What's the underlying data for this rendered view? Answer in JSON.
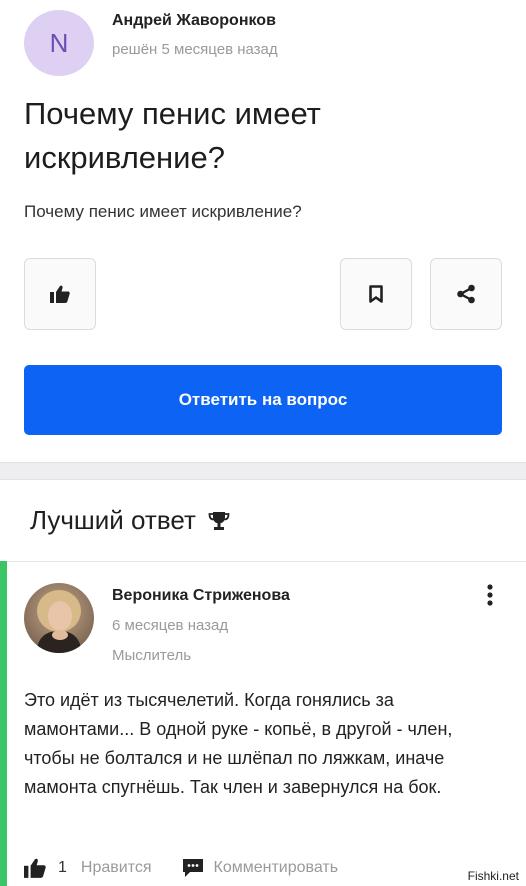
{
  "question": {
    "author": {
      "initial": "N",
      "name": "Андрей Жаворонков",
      "meta": "решён 5 месяцев назад",
      "avatar_color": "#ddd0f2"
    },
    "title": "Почему пенис имеет искривление?",
    "body": "Почему пенис имеет искривление?",
    "actions": {
      "like_icon": "thumbs-up-icon",
      "bookmark_icon": "bookmark-icon",
      "share_icon": "share-icon"
    },
    "answer_button_label": "Ответить на вопрос",
    "accent_color": "#0d63f3"
  },
  "best_answer": {
    "section_title": "Лучший ответ",
    "section_icon": "trophy-icon",
    "author": {
      "name": "Вероника Стриженова",
      "date": "6 месяцев назад",
      "rank": "Мыслитель"
    },
    "text": "Это идёт из тысячелетий. Когда гонялись за мамонтами... В одной руке - копьё, в другой - член, чтобы не болтался и не шлёпал по ляжкам, иначе мамонта спугнёшь. Так член и завернулся на бок.",
    "likes_count": "1",
    "like_label": "Нравится",
    "comment_label": "Комментировать",
    "highlight_color": "#3cc567"
  },
  "watermark": "Fishki.net"
}
